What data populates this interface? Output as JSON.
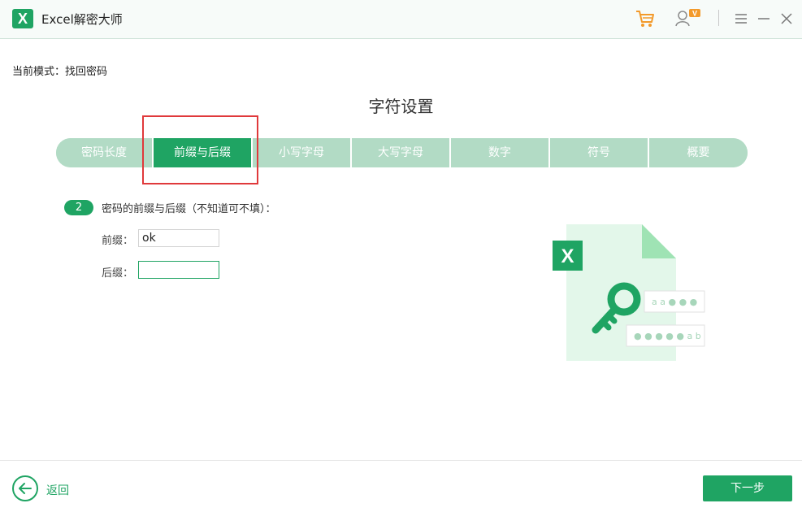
{
  "app": {
    "logo_letter": "X",
    "title": "Excel解密大师"
  },
  "titlebar": {
    "icons": [
      "cart-icon",
      "user-vip-icon",
      "menu-icon",
      "minimize-icon",
      "close-icon"
    ],
    "vip_badge": "V"
  },
  "mode": {
    "label": "当前模式：找回密码"
  },
  "page": {
    "title": "字符设置"
  },
  "tabs": [
    {
      "label": "密码长度",
      "active": false
    },
    {
      "label": "前缀与后缀",
      "active": true
    },
    {
      "label": "小写字母",
      "active": false
    },
    {
      "label": "大写字母",
      "active": false
    },
    {
      "label": "数字",
      "active": false
    },
    {
      "label": "符号",
      "active": false
    },
    {
      "label": "概要",
      "active": false
    }
  ],
  "step": {
    "number": "2",
    "text": "密码的前缀与后缀（不知道可不填）："
  },
  "prefix": {
    "label": "前缀：",
    "value": "ok"
  },
  "suffix": {
    "label": "后缀：",
    "value": ""
  },
  "illustration": {
    "file_letter": "X",
    "field1_text": "a a ● ● ●",
    "field2_text": "● ● ● ● ● a b"
  },
  "footer": {
    "back_label": "返回",
    "next_label": "下一步"
  },
  "colors": {
    "accent": "#1fa463",
    "tab_inactive": "#b2dbc5",
    "highlight": "#e0393b",
    "illus_bg": "#e3f7ea"
  }
}
